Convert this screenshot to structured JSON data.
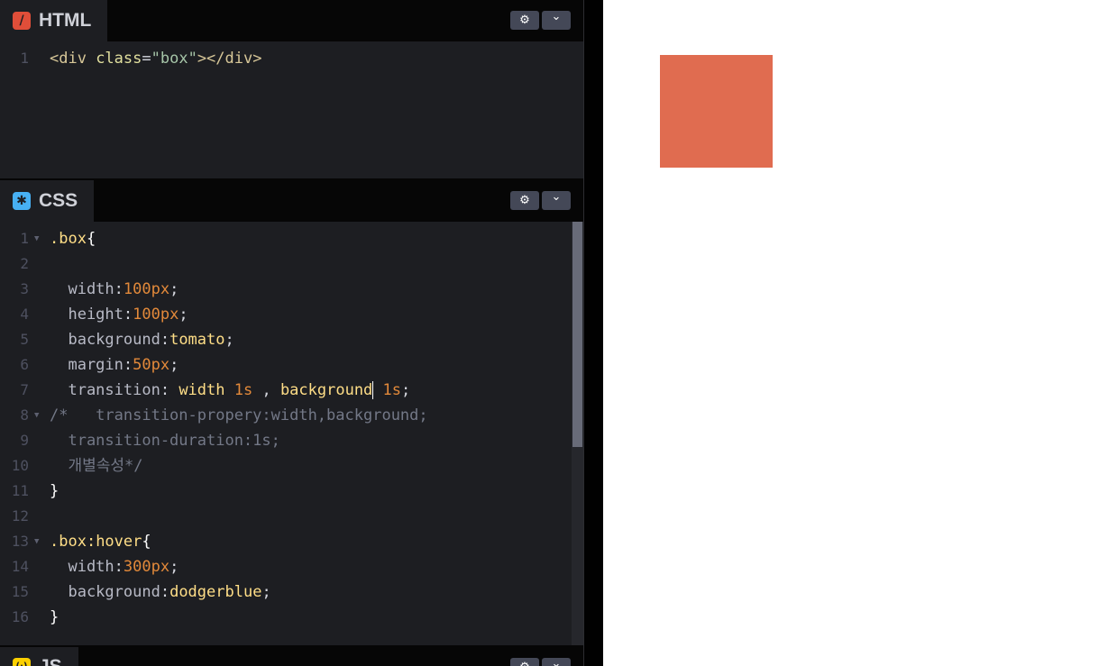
{
  "html_editor": {
    "title": "HTML",
    "icon_glyph": "/",
    "icon_name": "html-icon",
    "lines": [
      {
        "n": "1",
        "tokens": [
          {
            "t": "<div ",
            "c": "t-tag"
          },
          {
            "t": "class",
            "c": "t-attr"
          },
          {
            "t": "=",
            "c": "t-punc"
          },
          {
            "t": "\"box\"",
            "c": "t-str"
          },
          {
            "t": "></div>",
            "c": "t-tag"
          }
        ]
      }
    ]
  },
  "css_editor": {
    "title": "CSS",
    "icon_glyph": "✱",
    "icon_name": "css-icon",
    "lines": [
      {
        "n": "1",
        "fold": true,
        "tokens": [
          {
            "t": ".box",
            "c": "t-sel"
          },
          {
            "t": "{",
            "c": "t-brace"
          }
        ]
      },
      {
        "n": "2",
        "tokens": []
      },
      {
        "n": "3",
        "tokens": [
          {
            "t": "  width",
            "c": "t-prop"
          },
          {
            "t": ":",
            "c": "t-punc"
          },
          {
            "t": "100px",
            "c": "t-num"
          },
          {
            "t": ";",
            "c": "t-punc"
          }
        ]
      },
      {
        "n": "4",
        "tokens": [
          {
            "t": "  height",
            "c": "t-prop"
          },
          {
            "t": ":",
            "c": "t-punc"
          },
          {
            "t": "100px",
            "c": "t-num"
          },
          {
            "t": ";",
            "c": "t-punc"
          }
        ]
      },
      {
        "n": "5",
        "tokens": [
          {
            "t": "  background",
            "c": "t-prop"
          },
          {
            "t": ":",
            "c": "t-punc"
          },
          {
            "t": "tomato",
            "c": "t-val"
          },
          {
            "t": ";",
            "c": "t-punc"
          }
        ]
      },
      {
        "n": "6",
        "tokens": [
          {
            "t": "  margin",
            "c": "t-prop"
          },
          {
            "t": ":",
            "c": "t-punc"
          },
          {
            "t": "50px",
            "c": "t-num"
          },
          {
            "t": ";",
            "c": "t-punc"
          }
        ]
      },
      {
        "n": "7",
        "tokens": [
          {
            "t": "  transition",
            "c": "t-prop"
          },
          {
            "t": ": ",
            "c": "t-punc"
          },
          {
            "t": "width ",
            "c": "t-val"
          },
          {
            "t": "1s",
            "c": "t-num"
          },
          {
            "t": " , ",
            "c": "t-punc"
          },
          {
            "t": "background",
            "c": "t-val"
          },
          {
            "cursor": true
          },
          {
            "t": " 1s",
            "c": "t-num"
          },
          {
            "t": ";",
            "c": "t-punc"
          }
        ]
      },
      {
        "n": "8",
        "fold": true,
        "tokens": [
          {
            "t": "/*   transition-propery:width,background;",
            "c": "t-com"
          }
        ]
      },
      {
        "n": "9",
        "tokens": [
          {
            "t": "  transition-duration:1s;",
            "c": "t-com"
          }
        ]
      },
      {
        "n": "10",
        "tokens": [
          {
            "t": "  개별속성*/",
            "c": "t-com"
          }
        ]
      },
      {
        "n": "11",
        "tokens": [
          {
            "t": "}",
            "c": "t-brace"
          }
        ]
      },
      {
        "n": "12",
        "tokens": []
      },
      {
        "n": "13",
        "fold": true,
        "tokens": [
          {
            "t": ".box",
            "c": "t-sel"
          },
          {
            "t": ":hover",
            "c": "t-sel"
          },
          {
            "t": "{",
            "c": "t-brace"
          }
        ]
      },
      {
        "n": "14",
        "tokens": [
          {
            "t": "  width",
            "c": "t-prop"
          },
          {
            "t": ":",
            "c": "t-punc"
          },
          {
            "t": "300px",
            "c": "t-num"
          },
          {
            "t": ";",
            "c": "t-punc"
          }
        ]
      },
      {
        "n": "15",
        "tokens": [
          {
            "t": "  background",
            "c": "t-prop"
          },
          {
            "t": ":",
            "c": "t-punc"
          },
          {
            "t": "dodgerblue",
            "c": "t-val"
          },
          {
            "t": ";",
            "c": "t-punc"
          }
        ]
      },
      {
        "n": "16",
        "tokens": [
          {
            "t": "}",
            "c": "t-brace"
          }
        ]
      }
    ]
  },
  "js_editor": {
    "title": "JS",
    "icon_glyph": "(·)",
    "icon_name": "js-icon"
  },
  "header_buttons": {
    "settings_icon": "⚙",
    "collapse_icon": "⌄"
  },
  "colors": {
    "editor_bg": "#1d1e22",
    "header_bg": "#060606",
    "preview_box": "#e06c50",
    "html_accent": "#e04e39",
    "css_accent": "#47b0f3",
    "js_accent": "#fcd000"
  }
}
